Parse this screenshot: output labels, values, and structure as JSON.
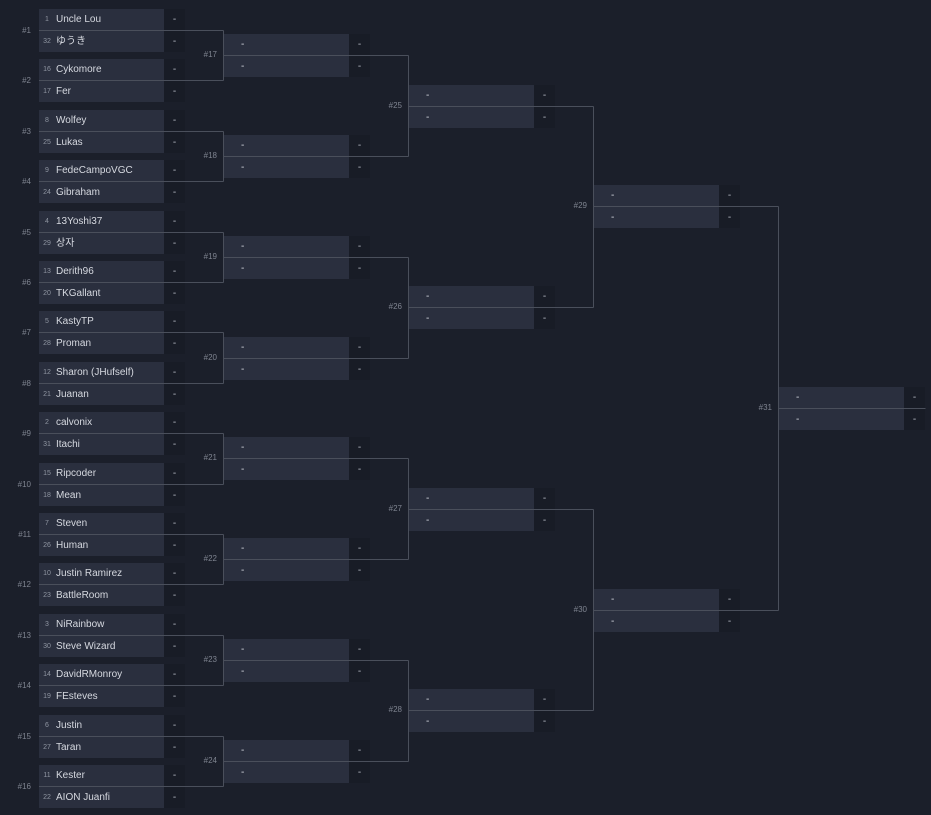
{
  "bracket": {
    "rounds": [
      {
        "matches": [
          {
            "id": "#1",
            "players": [
              {
                "seed": "1",
                "name": "Uncle Lou",
                "score": "-"
              },
              {
                "seed": "32",
                "name": "ゆうき",
                "score": "-"
              }
            ]
          },
          {
            "id": "#2",
            "players": [
              {
                "seed": "16",
                "name": "Cykomore",
                "score": "-"
              },
              {
                "seed": "17",
                "name": "Fer",
                "score": "-"
              }
            ]
          },
          {
            "id": "#3",
            "players": [
              {
                "seed": "8",
                "name": "Wolfey",
                "score": "-"
              },
              {
                "seed": "25",
                "name": "Lukas",
                "score": "-"
              }
            ]
          },
          {
            "id": "#4",
            "players": [
              {
                "seed": "9",
                "name": "FedeCampoVGC",
                "score": "-"
              },
              {
                "seed": "24",
                "name": "Gibraham",
                "score": "-"
              }
            ]
          },
          {
            "id": "#5",
            "players": [
              {
                "seed": "4",
                "name": "13Yoshi37",
                "score": "-"
              },
              {
                "seed": "29",
                "name": "상자",
                "score": "-"
              }
            ]
          },
          {
            "id": "#6",
            "players": [
              {
                "seed": "13",
                "name": "Derith96",
                "score": "-"
              },
              {
                "seed": "20",
                "name": "TKGallant",
                "score": "-"
              }
            ]
          },
          {
            "id": "#7",
            "players": [
              {
                "seed": "5",
                "name": "KastyTP",
                "score": "-"
              },
              {
                "seed": "28",
                "name": "Proman",
                "score": "-"
              }
            ]
          },
          {
            "id": "#8",
            "players": [
              {
                "seed": "12",
                "name": "Sharon (JHufself)",
                "score": "-"
              },
              {
                "seed": "21",
                "name": "Juanan",
                "score": "-"
              }
            ]
          },
          {
            "id": "#9",
            "players": [
              {
                "seed": "2",
                "name": "calvonix",
                "score": "-"
              },
              {
                "seed": "31",
                "name": "Itachi",
                "score": "-"
              }
            ]
          },
          {
            "id": "#10",
            "players": [
              {
                "seed": "15",
                "name": "Ripcoder",
                "score": "-"
              },
              {
                "seed": "18",
                "name": "Mean",
                "score": "-"
              }
            ]
          },
          {
            "id": "#11",
            "players": [
              {
                "seed": "7",
                "name": "Steven",
                "score": "-"
              },
              {
                "seed": "26",
                "name": "Human",
                "score": "-"
              }
            ]
          },
          {
            "id": "#12",
            "players": [
              {
                "seed": "10",
                "name": "Justin Ramirez",
                "score": "-"
              },
              {
                "seed": "23",
                "name": "BattleRoom",
                "score": "-"
              }
            ]
          },
          {
            "id": "#13",
            "players": [
              {
                "seed": "3",
                "name": "NiRainbow",
                "score": "-"
              },
              {
                "seed": "30",
                "name": "Steve Wizard",
                "score": "-"
              }
            ]
          },
          {
            "id": "#14",
            "players": [
              {
                "seed": "14",
                "name": "DavidRMonroy",
                "score": "-"
              },
              {
                "seed": "19",
                "name": "FEsteves",
                "score": "-"
              }
            ]
          },
          {
            "id": "#15",
            "players": [
              {
                "seed": "6",
                "name": "Justin",
                "score": "-"
              },
              {
                "seed": "27",
                "name": "Taran",
                "score": "-"
              }
            ]
          },
          {
            "id": "#16",
            "players": [
              {
                "seed": "11",
                "name": "Kester",
                "score": "-"
              },
              {
                "seed": "22",
                "name": "AION Juanfi",
                "score": "-"
              }
            ]
          }
        ]
      },
      {
        "matches": [
          {
            "id": "#17",
            "players": [
              {
                "seed": "",
                "name": "-",
                "score": "-"
              },
              {
                "seed": "",
                "name": "-",
                "score": "-"
              }
            ]
          },
          {
            "id": "#18",
            "players": [
              {
                "seed": "",
                "name": "-",
                "score": "-"
              },
              {
                "seed": "",
                "name": "-",
                "score": "-"
              }
            ]
          },
          {
            "id": "#19",
            "players": [
              {
                "seed": "",
                "name": "-",
                "score": "-"
              },
              {
                "seed": "",
                "name": "-",
                "score": "-"
              }
            ]
          },
          {
            "id": "#20",
            "players": [
              {
                "seed": "",
                "name": "-",
                "score": "-"
              },
              {
                "seed": "",
                "name": "-",
                "score": "-"
              }
            ]
          },
          {
            "id": "#21",
            "players": [
              {
                "seed": "",
                "name": "-",
                "score": "-"
              },
              {
                "seed": "",
                "name": "-",
                "score": "-"
              }
            ]
          },
          {
            "id": "#22",
            "players": [
              {
                "seed": "",
                "name": "-",
                "score": "-"
              },
              {
                "seed": "",
                "name": "-",
                "score": "-"
              }
            ]
          },
          {
            "id": "#23",
            "players": [
              {
                "seed": "",
                "name": "-",
                "score": "-"
              },
              {
                "seed": "",
                "name": "-",
                "score": "-"
              }
            ]
          },
          {
            "id": "#24",
            "players": [
              {
                "seed": "",
                "name": "-",
                "score": "-"
              },
              {
                "seed": "",
                "name": "-",
                "score": "-"
              }
            ]
          }
        ]
      },
      {
        "matches": [
          {
            "id": "#25",
            "players": [
              {
                "seed": "",
                "name": "-",
                "score": "-"
              },
              {
                "seed": "",
                "name": "-",
                "score": "-"
              }
            ]
          },
          {
            "id": "#26",
            "players": [
              {
                "seed": "",
                "name": "-",
                "score": "-"
              },
              {
                "seed": "",
                "name": "-",
                "score": "-"
              }
            ]
          },
          {
            "id": "#27",
            "players": [
              {
                "seed": "",
                "name": "-",
                "score": "-"
              },
              {
                "seed": "",
                "name": "-",
                "score": "-"
              }
            ]
          },
          {
            "id": "#28",
            "players": [
              {
                "seed": "",
                "name": "-",
                "score": "-"
              },
              {
                "seed": "",
                "name": "-",
                "score": "-"
              }
            ]
          }
        ]
      },
      {
        "matches": [
          {
            "id": "#29",
            "players": [
              {
                "seed": "",
                "name": "-",
                "score": "-"
              },
              {
                "seed": "",
                "name": "-",
                "score": "-"
              }
            ]
          },
          {
            "id": "#30",
            "players": [
              {
                "seed": "",
                "name": "-",
                "score": "-"
              },
              {
                "seed": "",
                "name": "-",
                "score": "-"
              }
            ]
          }
        ]
      },
      {
        "matches": [
          {
            "id": "#31",
            "players": [
              {
                "seed": "",
                "name": "-",
                "score": "-"
              },
              {
                "seed": "",
                "name": "-",
                "score": "-"
              }
            ]
          }
        ]
      }
    ]
  }
}
